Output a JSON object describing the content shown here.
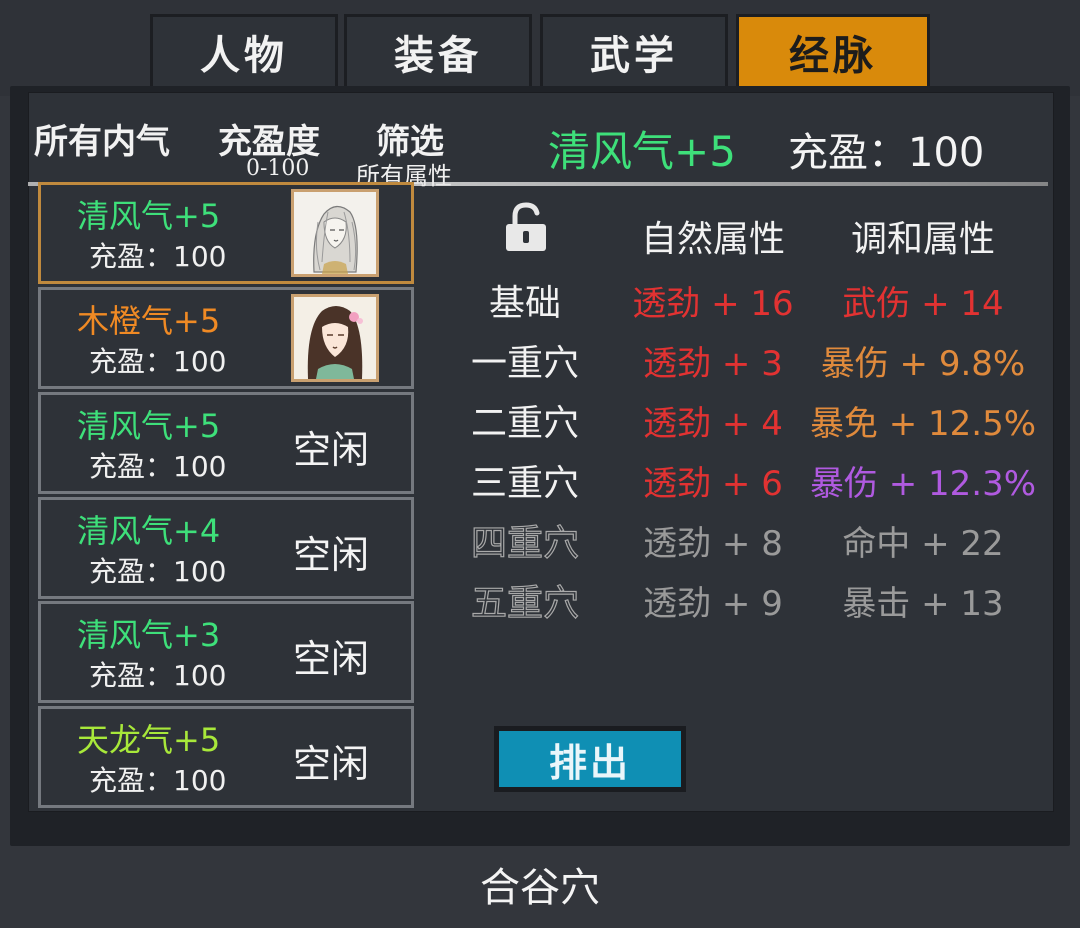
{
  "tabs": [
    {
      "label": "人物",
      "active": false
    },
    {
      "label": "装备",
      "active": false
    },
    {
      "label": "武学",
      "active": false
    },
    {
      "label": "经脉",
      "active": true
    }
  ],
  "filters": {
    "all_qi": "所有内气",
    "fill_label": "充盈度",
    "fill_range": "0-100",
    "filter_label": "筛选",
    "filter_value": "所有属性"
  },
  "selected": {
    "name": "清风气+5",
    "fill": "充盈：100"
  },
  "qi_list": [
    {
      "name": "清风气+5",
      "color": "#3ee07a",
      "fill": "充盈：100",
      "status": "portrait-1"
    },
    {
      "name": "木橙气+5",
      "color": "#f08a24",
      "fill": "充盈：100",
      "status": "portrait-2"
    },
    {
      "name": "清风气+5",
      "color": "#3ee07a",
      "fill": "充盈：100",
      "status": "空闲"
    },
    {
      "name": "清风气+4",
      "color": "#3ee07a",
      "fill": "充盈：100",
      "status": "空闲"
    },
    {
      "name": "清风气+3",
      "color": "#3ee07a",
      "fill": "充盈：100",
      "status": "空闲"
    },
    {
      "name": "天龙气+5",
      "color": "#a8e83a",
      "fill": "充盈：100",
      "status": "空闲"
    }
  ],
  "table": {
    "lock_icon": "unlock-icon",
    "headers": {
      "natural": "自然属性",
      "harmony": "调和属性"
    },
    "rows": [
      {
        "level": "基础",
        "natural": "透劲 + 16",
        "natural_color": "#e23232",
        "harmony": "武伤 + 14",
        "harmony_color": "#e23232",
        "locked": false
      },
      {
        "level": "一重穴",
        "natural": "透劲 + 3",
        "natural_color": "#e23232",
        "harmony": "暴伤 + 9.8%",
        "harmony_color": "#e08a3c",
        "locked": false
      },
      {
        "level": "二重穴",
        "natural": "透劲 + 4",
        "natural_color": "#e23232",
        "harmony": "暴免 + 12.5%",
        "harmony_color": "#e08a3c",
        "locked": false
      },
      {
        "level": "三重穴",
        "natural": "透劲 + 6",
        "natural_color": "#e23232",
        "harmony": "暴伤 + 12.3%",
        "harmony_color": "#b05ae0",
        "locked": false
      },
      {
        "level": "四重穴",
        "natural": "透劲 + 8",
        "natural_color": "#9a9a9a",
        "harmony": "命中 + 22",
        "harmony_color": "#9a9a9a",
        "locked": true
      },
      {
        "level": "五重穴",
        "natural": "透劲 + 9",
        "natural_color": "#9a9a9a",
        "harmony": "暴击 + 13",
        "harmony_color": "#9a9a9a",
        "locked": true
      }
    ]
  },
  "eject_button": "排出",
  "footer": "合谷穴"
}
